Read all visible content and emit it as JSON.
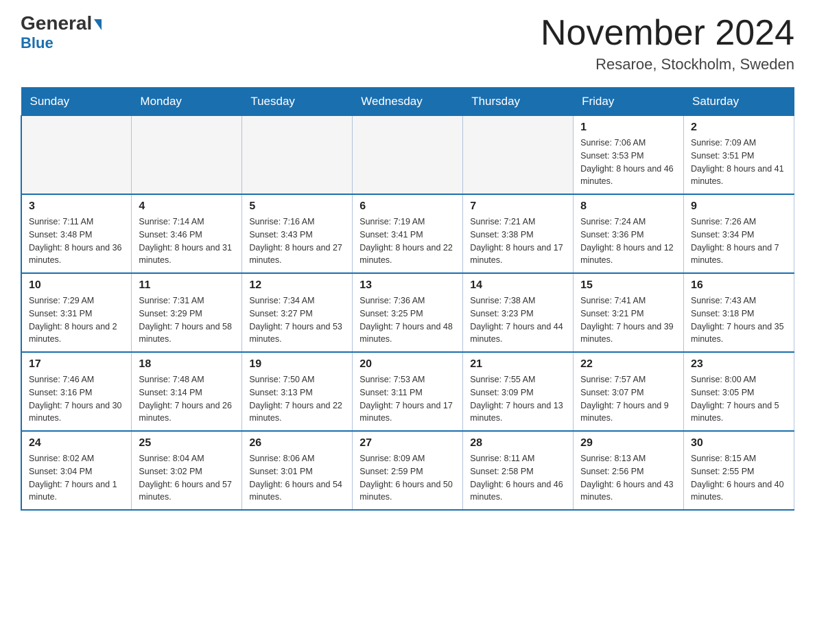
{
  "header": {
    "logo_main": "General",
    "logo_blue": "Blue",
    "month_title": "November 2024",
    "location": "Resaroe, Stockholm, Sweden"
  },
  "days_of_week": [
    "Sunday",
    "Monday",
    "Tuesday",
    "Wednesday",
    "Thursday",
    "Friday",
    "Saturday"
  ],
  "weeks": [
    [
      {
        "day": "",
        "info": ""
      },
      {
        "day": "",
        "info": ""
      },
      {
        "day": "",
        "info": ""
      },
      {
        "day": "",
        "info": ""
      },
      {
        "day": "",
        "info": ""
      },
      {
        "day": "1",
        "info": "Sunrise: 7:06 AM\nSunset: 3:53 PM\nDaylight: 8 hours and 46 minutes."
      },
      {
        "day": "2",
        "info": "Sunrise: 7:09 AM\nSunset: 3:51 PM\nDaylight: 8 hours and 41 minutes."
      }
    ],
    [
      {
        "day": "3",
        "info": "Sunrise: 7:11 AM\nSunset: 3:48 PM\nDaylight: 8 hours and 36 minutes."
      },
      {
        "day": "4",
        "info": "Sunrise: 7:14 AM\nSunset: 3:46 PM\nDaylight: 8 hours and 31 minutes."
      },
      {
        "day": "5",
        "info": "Sunrise: 7:16 AM\nSunset: 3:43 PM\nDaylight: 8 hours and 27 minutes."
      },
      {
        "day": "6",
        "info": "Sunrise: 7:19 AM\nSunset: 3:41 PM\nDaylight: 8 hours and 22 minutes."
      },
      {
        "day": "7",
        "info": "Sunrise: 7:21 AM\nSunset: 3:38 PM\nDaylight: 8 hours and 17 minutes."
      },
      {
        "day": "8",
        "info": "Sunrise: 7:24 AM\nSunset: 3:36 PM\nDaylight: 8 hours and 12 minutes."
      },
      {
        "day": "9",
        "info": "Sunrise: 7:26 AM\nSunset: 3:34 PM\nDaylight: 8 hours and 7 minutes."
      }
    ],
    [
      {
        "day": "10",
        "info": "Sunrise: 7:29 AM\nSunset: 3:31 PM\nDaylight: 8 hours and 2 minutes."
      },
      {
        "day": "11",
        "info": "Sunrise: 7:31 AM\nSunset: 3:29 PM\nDaylight: 7 hours and 58 minutes."
      },
      {
        "day": "12",
        "info": "Sunrise: 7:34 AM\nSunset: 3:27 PM\nDaylight: 7 hours and 53 minutes."
      },
      {
        "day": "13",
        "info": "Sunrise: 7:36 AM\nSunset: 3:25 PM\nDaylight: 7 hours and 48 minutes."
      },
      {
        "day": "14",
        "info": "Sunrise: 7:38 AM\nSunset: 3:23 PM\nDaylight: 7 hours and 44 minutes."
      },
      {
        "day": "15",
        "info": "Sunrise: 7:41 AM\nSunset: 3:21 PM\nDaylight: 7 hours and 39 minutes."
      },
      {
        "day": "16",
        "info": "Sunrise: 7:43 AM\nSunset: 3:18 PM\nDaylight: 7 hours and 35 minutes."
      }
    ],
    [
      {
        "day": "17",
        "info": "Sunrise: 7:46 AM\nSunset: 3:16 PM\nDaylight: 7 hours and 30 minutes."
      },
      {
        "day": "18",
        "info": "Sunrise: 7:48 AM\nSunset: 3:14 PM\nDaylight: 7 hours and 26 minutes."
      },
      {
        "day": "19",
        "info": "Sunrise: 7:50 AM\nSunset: 3:13 PM\nDaylight: 7 hours and 22 minutes."
      },
      {
        "day": "20",
        "info": "Sunrise: 7:53 AM\nSunset: 3:11 PM\nDaylight: 7 hours and 17 minutes."
      },
      {
        "day": "21",
        "info": "Sunrise: 7:55 AM\nSunset: 3:09 PM\nDaylight: 7 hours and 13 minutes."
      },
      {
        "day": "22",
        "info": "Sunrise: 7:57 AM\nSunset: 3:07 PM\nDaylight: 7 hours and 9 minutes."
      },
      {
        "day": "23",
        "info": "Sunrise: 8:00 AM\nSunset: 3:05 PM\nDaylight: 7 hours and 5 minutes."
      }
    ],
    [
      {
        "day": "24",
        "info": "Sunrise: 8:02 AM\nSunset: 3:04 PM\nDaylight: 7 hours and 1 minute."
      },
      {
        "day": "25",
        "info": "Sunrise: 8:04 AM\nSunset: 3:02 PM\nDaylight: 6 hours and 57 minutes."
      },
      {
        "day": "26",
        "info": "Sunrise: 8:06 AM\nSunset: 3:01 PM\nDaylight: 6 hours and 54 minutes."
      },
      {
        "day": "27",
        "info": "Sunrise: 8:09 AM\nSunset: 2:59 PM\nDaylight: 6 hours and 50 minutes."
      },
      {
        "day": "28",
        "info": "Sunrise: 8:11 AM\nSunset: 2:58 PM\nDaylight: 6 hours and 46 minutes."
      },
      {
        "day": "29",
        "info": "Sunrise: 8:13 AM\nSunset: 2:56 PM\nDaylight: 6 hours and 43 minutes."
      },
      {
        "day": "30",
        "info": "Sunrise: 8:15 AM\nSunset: 2:55 PM\nDaylight: 6 hours and 40 minutes."
      }
    ]
  ]
}
